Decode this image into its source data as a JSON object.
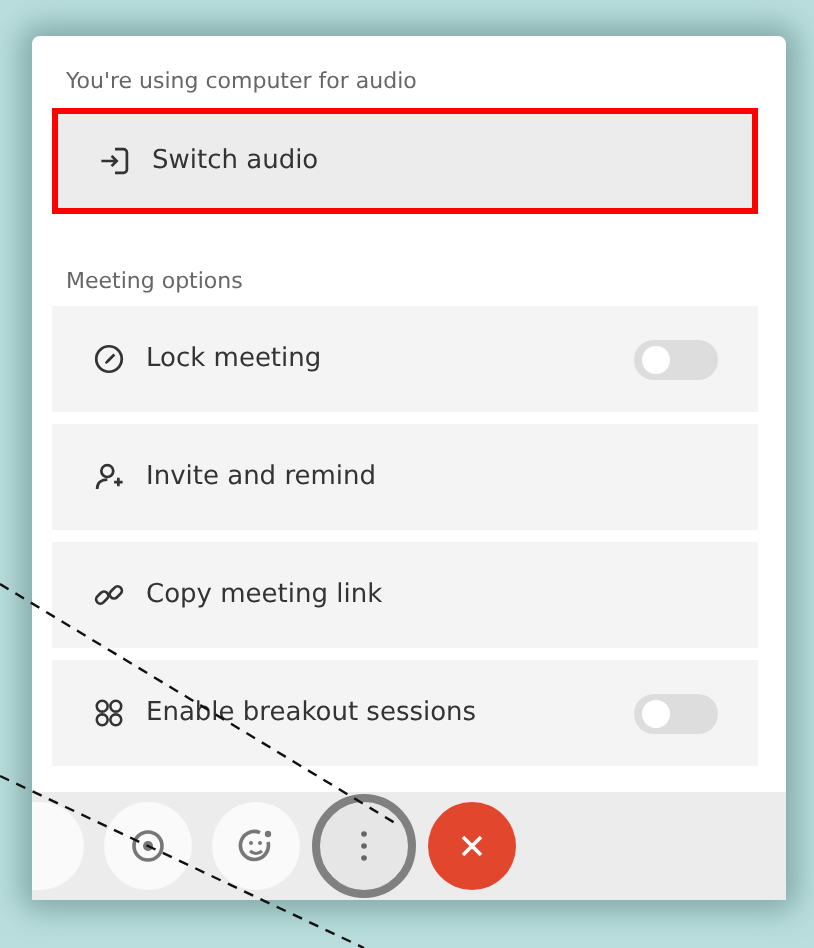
{
  "audio": {
    "caption": "You're using computer for audio",
    "action": {
      "label": "Switch audio",
      "highlighted": true
    }
  },
  "meeting_options": {
    "caption": "Meeting options",
    "items": [
      {
        "kind": "toggle",
        "label": "Lock meeting",
        "on": false
      },
      {
        "kind": "action",
        "label": "Invite and remind"
      },
      {
        "kind": "action",
        "label": "Copy meeting link"
      },
      {
        "kind": "toggle",
        "label": "Enable breakout sessions",
        "on": false
      }
    ]
  },
  "toolbar": {
    "buttons": [
      {
        "kind": "partial",
        "circled": false
      },
      {
        "kind": "camera",
        "circled": false
      },
      {
        "kind": "reaction",
        "circled": false
      },
      {
        "kind": "more",
        "circled": true
      },
      {
        "kind": "end",
        "circled": false
      }
    ]
  }
}
